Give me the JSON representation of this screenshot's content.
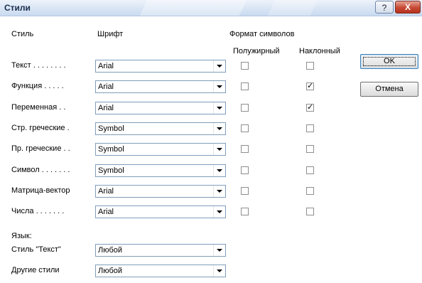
{
  "window": {
    "title": "Стили",
    "help_glyph": "?",
    "close_glyph": "X"
  },
  "headers": {
    "style": "Стиль",
    "font": "Шрифт",
    "char_format": "Формат символов",
    "bold": "Полужирный",
    "italic": "Наклонный"
  },
  "rows": [
    {
      "label": "Текст . . . . . . . .",
      "font": "Arial",
      "bold": false,
      "italic": false
    },
    {
      "label": "Функция . . . . .",
      "font": "Arial",
      "bold": false,
      "italic": true
    },
    {
      "label": "Переменная . .",
      "font": "Arial",
      "bold": false,
      "italic": true
    },
    {
      "label": "Стр. греческие .",
      "font": "Symbol",
      "bold": false,
      "italic": false
    },
    {
      "label": "Пр. греческие . .",
      "font": "Symbol",
      "bold": false,
      "italic": false
    },
    {
      "label": "Символ . . . . . . .",
      "font": "Symbol",
      "bold": false,
      "italic": false
    },
    {
      "label": "Матрица-вектор",
      "font": "Arial",
      "bold": false,
      "italic": false
    },
    {
      "label": "Числа . . . . . . .",
      "font": "Arial",
      "bold": false,
      "italic": false
    }
  ],
  "language": {
    "heading": "Язык:",
    "rows": [
      {
        "label": "Стиль \"Текст\"",
        "value": "Любой"
      },
      {
        "label": "Другие стили",
        "value": "Любой"
      }
    ]
  },
  "buttons": {
    "ok": "OK",
    "cancel": "Отмена"
  },
  "check_glyph": "✓",
  "colors": {
    "title_text": "#1a2e4e",
    "close_button": "#c74a35",
    "field_border": "#7f9db9"
  }
}
